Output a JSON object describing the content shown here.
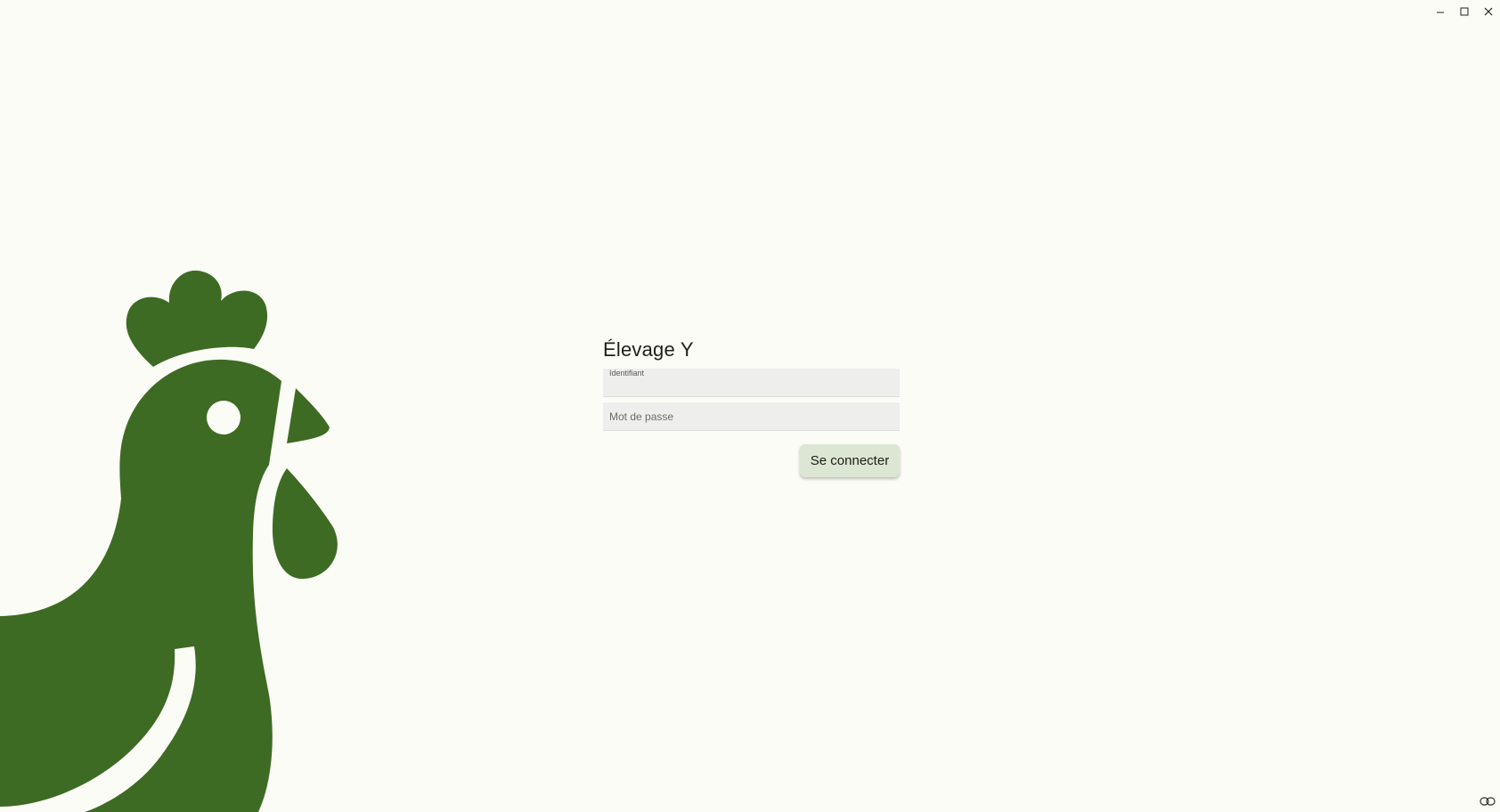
{
  "window": {
    "controls": {
      "minimize_icon": "minimize-icon",
      "maximize_icon": "maximize-icon",
      "close_icon": "close-icon"
    }
  },
  "illustration": {
    "icon": "rooster-icon",
    "color": "#3e6b23"
  },
  "login": {
    "title": "Élevage Y",
    "username": {
      "label": "Identifiant",
      "value": ""
    },
    "password": {
      "placeholder": "Mot de passe",
      "value": ""
    },
    "submit_label": "Se connecter"
  },
  "footer": {
    "icon": "link-icon"
  },
  "colors": {
    "background": "#fbfcf6",
    "accent": "#3e6b23",
    "button_bg": "#dde6d2",
    "field_bg": "#eeeeec"
  }
}
